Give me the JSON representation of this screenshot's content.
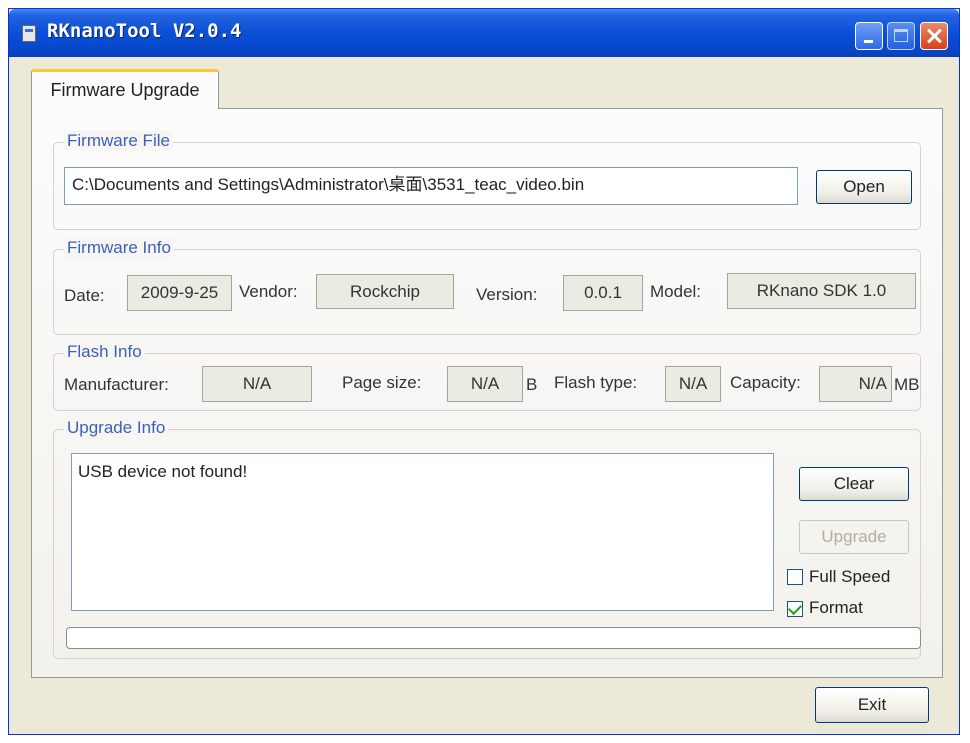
{
  "window": {
    "title": "RKnanoTool V2.0.4"
  },
  "tabs": [
    {
      "label": "Firmware Upgrade",
      "active": true
    }
  ],
  "firmware_file": {
    "group_label": "Firmware File",
    "path": "C:\\Documents and Settings\\Administrator\\桌面\\3531_teac_video.bin",
    "open_label": "Open"
  },
  "firmware_info": {
    "group_label": "Firmware Info",
    "date_label": "Date:",
    "date": "2009-9-25",
    "vendor_label": "Vendor:",
    "vendor": "Rockchip",
    "version_label": "Version:",
    "version": "0.0.1",
    "model_label": "Model:",
    "model": "RKnano SDK 1.0"
  },
  "flash_info": {
    "group_label": "Flash Info",
    "manufacturer_label": "Manufacturer:",
    "manufacturer": "N/A",
    "page_size_label": "Page size:",
    "page_size": "N/A",
    "page_size_unit": "B",
    "flash_type_label": "Flash type:",
    "flash_type": "N/A",
    "capacity_label": "Capacity:",
    "capacity": "N/A",
    "capacity_unit": "MB"
  },
  "upgrade_info": {
    "group_label": "Upgrade Info",
    "log": "USB device not found!",
    "clear_label": "Clear",
    "upgrade_label": "Upgrade",
    "upgrade_enabled": false,
    "full_speed_label": "Full Speed",
    "full_speed_checked": false,
    "format_label": "Format",
    "format_checked": true,
    "progress": 0
  },
  "footer": {
    "exit_label": "Exit"
  },
  "colors": {
    "titlebar": "#0a50d8",
    "group_label": "#3a5fbe",
    "tab_highlight": "#ffc83c",
    "check": "#21a121"
  },
  "icons": [
    "app-icon",
    "minimize-icon",
    "maximize-icon",
    "close-icon",
    "checkmark-icon"
  ]
}
